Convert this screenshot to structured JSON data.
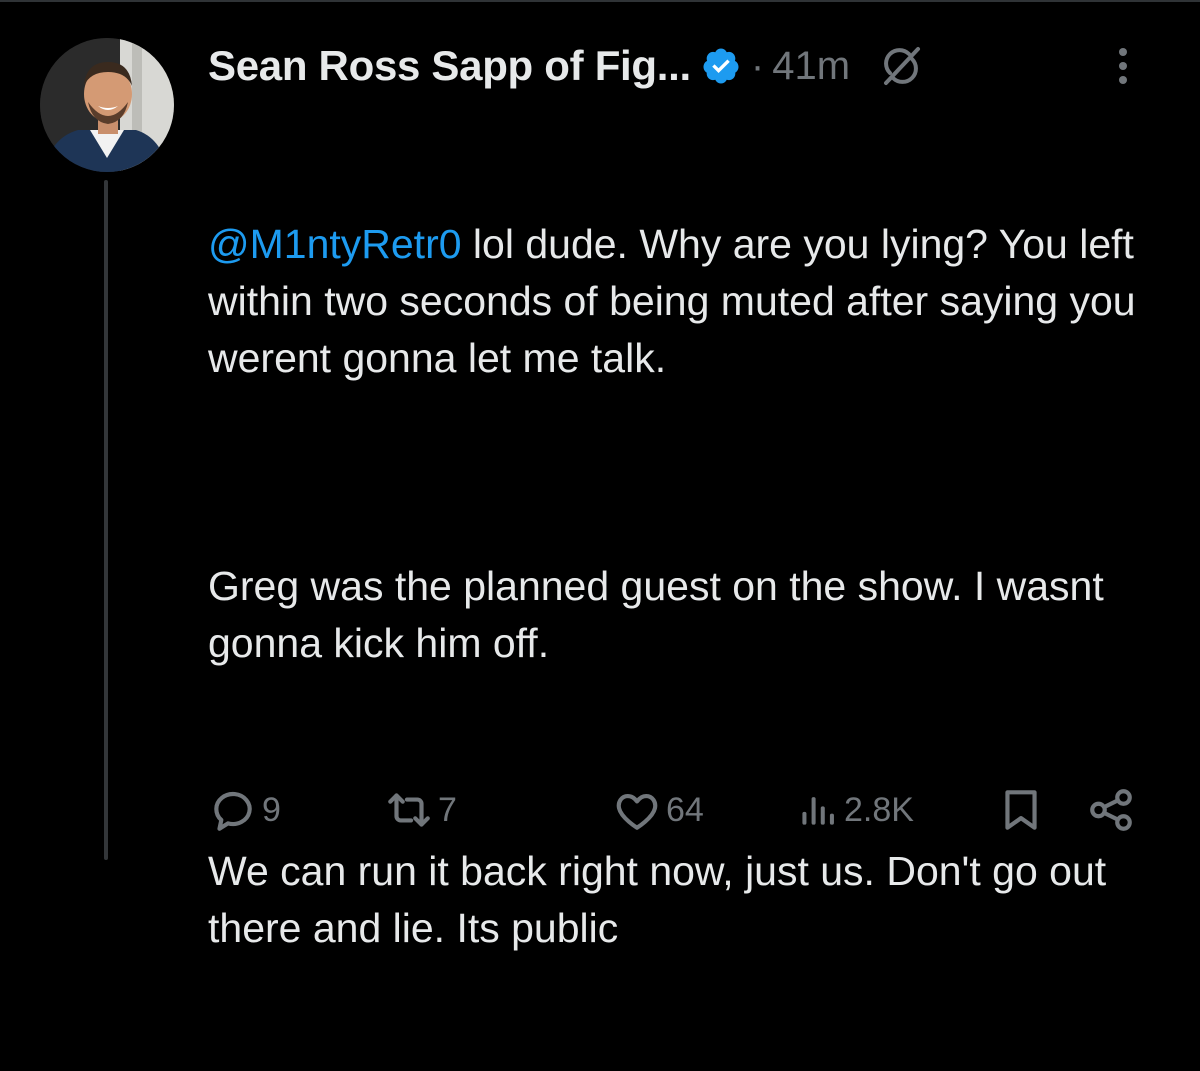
{
  "tweet": {
    "author_name": "Sean Ross Sapp of Fig...",
    "separator": "·",
    "time": "41m",
    "mention": "@M1ntyRetr0",
    "first_line_rest": " lol dude. Why are you lying? You left within two seconds of being muted after saying you werent gonna let me talk.",
    "paragraph_2": "Greg was the planned guest on the show. I wasnt gonna kick him off.",
    "paragraph_3": "We can run it back right now, just us. Don't go out there and lie. Its public"
  },
  "actions": {
    "replies": "9",
    "reposts": "7",
    "likes": "64",
    "views": "2.8K"
  },
  "icons": {
    "verified": "verified-badge-icon",
    "grok": "grok-icon",
    "more": "more-vertical-icon",
    "reply": "reply-icon",
    "repost": "repost-icon",
    "like": "heart-icon",
    "views": "views-icon",
    "bookmark": "bookmark-icon",
    "share": "share-icon"
  },
  "colors": {
    "background": "#000000",
    "text": "#e7e9ea",
    "muted": "#71767b",
    "accent": "#1d9bf0"
  }
}
